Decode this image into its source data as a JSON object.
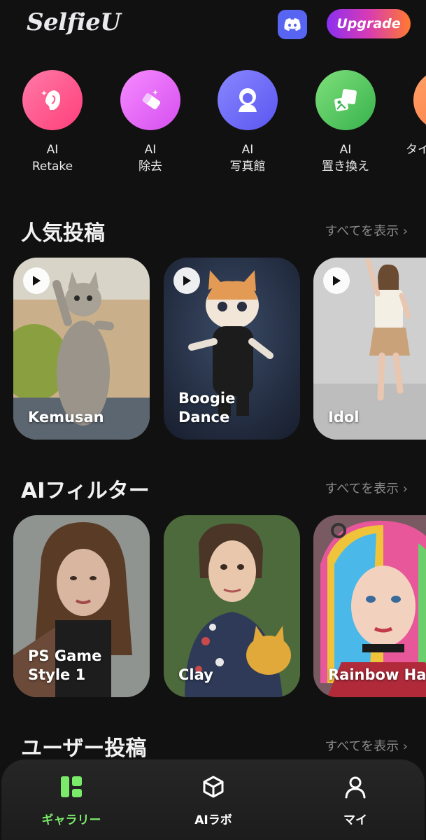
{
  "header": {
    "logo": "SelfieU",
    "upgrade_label": "Upgrade",
    "discord_icon": "discord-icon"
  },
  "tools": [
    {
      "line1": "AI",
      "line2": "Retake",
      "icon": "face-sparkle-icon",
      "color_start": "#ff6fa2",
      "color_end": "#ff3f7a"
    },
    {
      "line1": "AI",
      "line2": "除去",
      "icon": "eraser-icon",
      "color_start": "#f37bff",
      "color_end": "#d54ff0"
    },
    {
      "line1": "AI",
      "line2": "写真館",
      "icon": "portrait-icon",
      "color_start": "#7c7bff",
      "color_end": "#5a56f0"
    },
    {
      "line1": "AI",
      "line2": "置き換え",
      "icon": "image-swap-icon",
      "color_start": "#6fdc6a",
      "color_end": "#37b24d"
    },
    {
      "line1": "",
      "line2": "タイ",
      "icon": "partial-icon",
      "color_start": "#ff9a62",
      "color_end": "#ff7a3d"
    }
  ],
  "sections": {
    "popular": {
      "title": "人気投稿",
      "see_all": "すべてを表示 ›"
    },
    "filters": {
      "title": "AIフィルター",
      "see_all": "すべてを表示 ›"
    },
    "user": {
      "title": "ユーザー投稿",
      "see_all": "すべてを表示 ›"
    }
  },
  "popular_cards": [
    {
      "label": "Kemusan"
    },
    {
      "label": "Boogie\nDance"
    },
    {
      "label": "Idol"
    }
  ],
  "filter_cards": [
    {
      "label": "PS Game\nStyle 1"
    },
    {
      "label": "Clay"
    },
    {
      "label": "Rainbow Hai"
    }
  ],
  "nav": [
    {
      "label": "ギャラリー",
      "icon": "gallery-icon",
      "active": true,
      "color": "#7bea6b"
    },
    {
      "label": "AIラボ",
      "icon": "cube-icon",
      "active": false,
      "color": "#ffffff"
    },
    {
      "label": "マイ",
      "icon": "person-icon",
      "active": false,
      "color": "#ffffff"
    }
  ]
}
